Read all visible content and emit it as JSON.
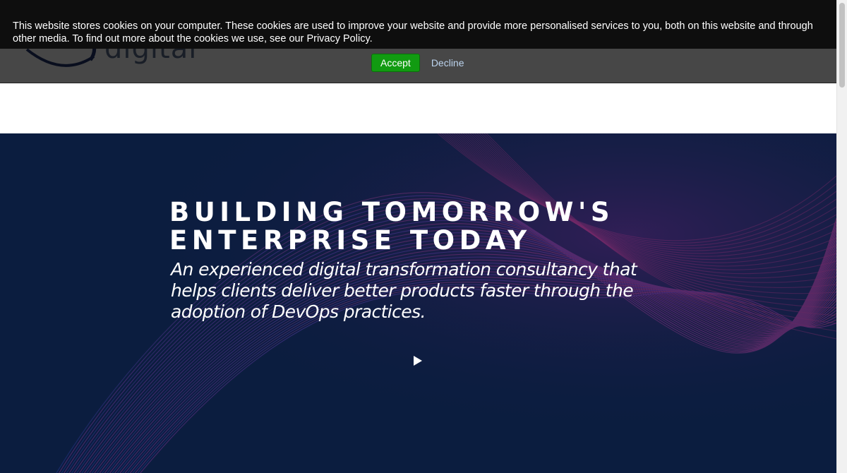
{
  "cookie_banner": {
    "message": "This website stores cookies on your computer. These cookies are used to improve your website and provide more personalised services to you, both on this website and through other media. To find out more about the cookies we use, see our Privacy Policy.",
    "accept_label": "Accept",
    "decline_label": "Decline"
  },
  "header": {
    "logo_text": "digital"
  },
  "hero": {
    "title_line1": "BUILDING TOMORROW'S",
    "title_line2": "ENTERPRISE TODAY",
    "subtitle": "An experienced digital transformation consultancy that helps clients deliver better products faster through the adoption of DevOps practices."
  },
  "colors": {
    "hero_bg": "#0b1d3f",
    "accent_pink": "#b0327a",
    "accent_blue": "#3a4fb8",
    "accept_green": "#119b11"
  },
  "icons": {
    "play": "play-icon",
    "logo": "logo-swoosh-icon"
  }
}
